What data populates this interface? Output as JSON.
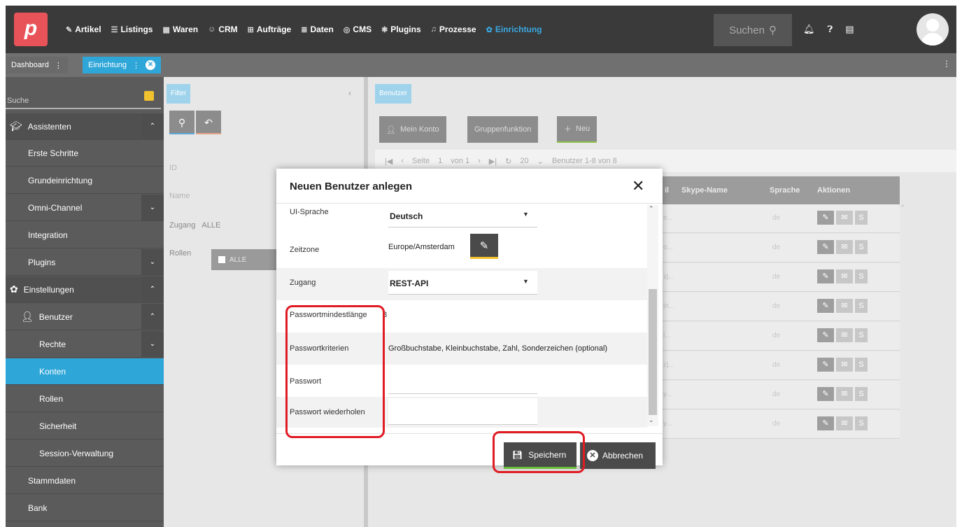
{
  "nav": {
    "items": [
      {
        "icon": "tag-icon",
        "glyph": "✎",
        "label": "Artikel"
      },
      {
        "icon": "list-icon",
        "glyph": "☰",
        "label": "Listings"
      },
      {
        "icon": "boxes-icon",
        "glyph": "▦",
        "label": "Waren"
      },
      {
        "icon": "users-icon",
        "glyph": "☺",
        "label": "CRM"
      },
      {
        "icon": "cart-icon",
        "glyph": "⊞",
        "label": "Aufträge"
      },
      {
        "icon": "database-icon",
        "glyph": "≣",
        "label": "Daten"
      },
      {
        "icon": "globe-icon",
        "glyph": "◎",
        "label": "CMS"
      },
      {
        "icon": "puzzle-icon",
        "glyph": "✱",
        "label": "Plugins"
      },
      {
        "icon": "process-icon",
        "glyph": "♫",
        "label": "Prozesse"
      },
      {
        "icon": "gear-icon",
        "glyph": "✿",
        "label": "Einrichtung"
      }
    ],
    "search_placeholder": "Suchen",
    "accent": "#3aa8e0",
    "logo_color": "#e8535a"
  },
  "tabs": [
    {
      "label": "Dashboard"
    },
    {
      "label": "Einrichtung"
    }
  ],
  "sidebar": {
    "search_label": "Suche",
    "items": [
      {
        "label": "Assistenten",
        "chevron": "^",
        "group": true,
        "icon": "wizard-icon",
        "glyph": "🎓"
      },
      {
        "label": "Erste Schritte"
      },
      {
        "label": "Grundeinrichtung"
      },
      {
        "label": "Omni-Channel",
        "chevron": "v"
      },
      {
        "label": "Integration"
      },
      {
        "label": "Plugins",
        "chevron": "v"
      },
      {
        "label": "Einstellungen",
        "chevron": "^",
        "group": true,
        "icon": "gear-icon",
        "glyph": "✿"
      },
      {
        "label": "Benutzer",
        "chevron": "^",
        "icon": "user-icon",
        "glyph": "👤"
      },
      {
        "label": "Rechte",
        "chevron": "v"
      },
      {
        "label": "Konten",
        "active": true
      },
      {
        "label": "Rollen"
      },
      {
        "label": "Sicherheit"
      },
      {
        "label": "Session-Verwaltung"
      },
      {
        "label": "Stammdaten"
      },
      {
        "label": "Bank"
      }
    ]
  },
  "filter": {
    "tab_label": "Filter",
    "id_label": "ID",
    "name_label": "Name",
    "zugang_label": "Zugang",
    "zugang_value": "ALLE",
    "rollen_label": "Rollen",
    "rollen_chip": "ALLE"
  },
  "main": {
    "tab_label": "Benutzer",
    "buttons": {
      "my_account": "Mein Konto",
      "group_function": "Gruppenfunktion",
      "new": "Neu"
    },
    "pager": {
      "page_label": "Seite",
      "page": "1",
      "of": "von 1",
      "per_page": "20",
      "summary": "Benutzer 1-8 von 8"
    },
    "table": {
      "headers": [
        "il",
        "Skype-Name",
        "Sprache",
        "Aktionen"
      ],
      "rows": [
        {
          "cut": "e...",
          "lang": "de"
        },
        {
          "cut": "o...",
          "lang": "de"
        },
        {
          "cut": "zj...",
          "lang": "de"
        },
        {
          "cut": "in...",
          "lang": "de"
        },
        {
          "cut": "i...",
          "lang": "de"
        },
        {
          "cut": "zj...",
          "lang": "de"
        },
        {
          "cut": "y...",
          "lang": "de"
        },
        {
          "cut": "y...",
          "lang": "de"
        }
      ]
    }
  },
  "modal": {
    "title": "Neuen Benutzer anlegen",
    "fields": {
      "ui_lang_label": "UI-Sprache",
      "ui_lang_value": "Deutsch",
      "timezone_label": "Zeitzone",
      "timezone_value": "Europe/Amsterdam",
      "access_label": "Zugang",
      "access_value": "REST-API",
      "pwd_min_label": "Passwortmindestlänge",
      "pwd_min_value": "8",
      "pwd_criteria_label": "Passwortkriterien",
      "pwd_criteria_value": "Großbuchstabe, Kleinbuchstabe, Zahl, Sonderzeichen (optional)",
      "pwd_label": "Passwort",
      "pwd_repeat_label": "Passwort wiederholen"
    },
    "save_label": "Speichern",
    "cancel_label": "Abbrechen",
    "highlight_color": "#e01b24"
  }
}
